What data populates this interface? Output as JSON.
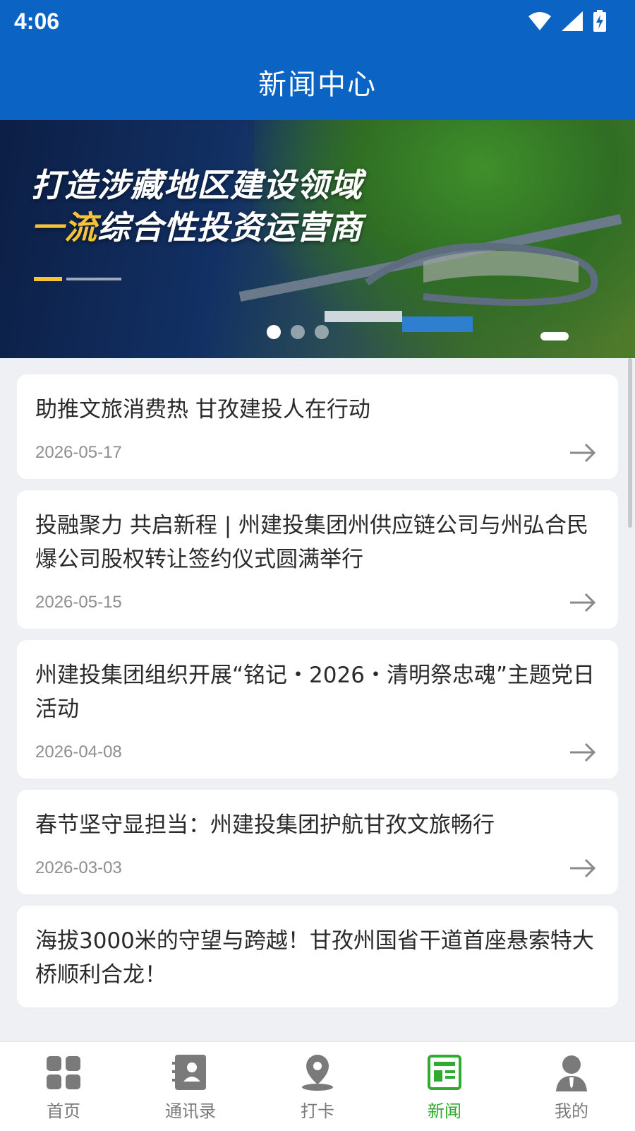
{
  "status_bar": {
    "time": "4:06"
  },
  "header": {
    "title": "新闻中心"
  },
  "banner": {
    "line1": "打造涉藏地区建设领域",
    "line2_accent": "一流",
    "line2_rest": "综合性投资运营商",
    "carousel_dots": 3,
    "active_index": 0
  },
  "news": [
    {
      "title": "助推文旅消费热 甘孜建投人在行动",
      "date": "2026-05-17"
    },
    {
      "title": "投融聚力 共启新程 | 州建投集团州供应链公司与州弘合民爆公司股权转让签约仪式圆满举行",
      "date": "2026-05-15"
    },
    {
      "title": "州建投集团组织开展“铭记・2026・清明祭忠魂”主题党日活动",
      "date": "2026-04-08"
    },
    {
      "title": "春节坚守显担当：州建投集团护航甘孜文旅畅行",
      "date": "2026-03-03"
    },
    {
      "title": "海拔3000米的守望与跨越！甘孜州国省干道首座悬索特大桥顺利合龙！",
      "date": ""
    }
  ],
  "tabs": [
    {
      "label": "首页",
      "icon": "grid-icon",
      "active": false
    },
    {
      "label": "通讯录",
      "icon": "contacts-icon",
      "active": false
    },
    {
      "label": "打卡",
      "icon": "location-pin-icon",
      "active": false
    },
    {
      "label": "新闻",
      "icon": "news-icon",
      "active": true
    },
    {
      "label": "我的",
      "icon": "profile-icon",
      "active": false
    }
  ],
  "colors": {
    "primary": "#0b63c4",
    "active_tab": "#2fab2f",
    "inactive_tab": "#7a7a7a"
  }
}
